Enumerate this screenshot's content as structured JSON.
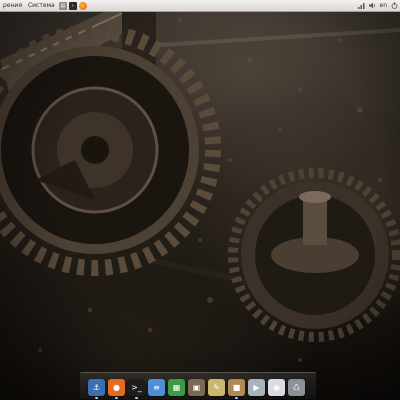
{
  "top_panel": {
    "menu_places": "рения",
    "menu_system": "Система",
    "tray_keyboard_layout": "en",
    "launchers": [
      {
        "name": "file-manager-launcher-icon",
        "glyph": "▤",
        "color": "#8c8c8c"
      },
      {
        "name": "terminal-launcher-icon",
        "glyph": ">_",
        "color": "#2b2b2b"
      },
      {
        "name": "firefox-launcher-icon",
        "glyph": "●",
        "color": "#e66a1f"
      }
    ]
  },
  "dock": {
    "items": [
      {
        "name": "anchor-app-icon",
        "glyph": "⚓",
        "color": "#3a6fb5",
        "running": true
      },
      {
        "name": "firefox-app-icon",
        "glyph": "●",
        "color": "#e66a1f",
        "running": true
      },
      {
        "name": "terminal-app-icon",
        "glyph": ">_",
        "color": "#1e1e1e",
        "running": true
      },
      {
        "name": "text-document-app-icon",
        "glyph": "≡",
        "color": "#4f8fd6",
        "running": false
      },
      {
        "name": "spreadsheet-app-icon",
        "glyph": "▦",
        "color": "#3d9a45",
        "running": false
      },
      {
        "name": "image-viewer-app-icon",
        "glyph": "▣",
        "color": "#7a6a52",
        "running": false
      },
      {
        "name": "text-editor-app-icon",
        "glyph": "✎",
        "color": "#c9b770",
        "running": false
      },
      {
        "name": "package-installer-app-icon",
        "glyph": "■",
        "color": "#b08a52",
        "running": true
      },
      {
        "name": "media-player-app-icon",
        "glyph": "▶",
        "color": "#a9b3bc",
        "running": false
      },
      {
        "name": "eye-viewer-app-icon",
        "glyph": "◉",
        "color": "#d9dde2",
        "running": false
      },
      {
        "name": "trash-app-icon",
        "glyph": "♺",
        "color": "#8d9298",
        "running": false
      }
    ]
  }
}
